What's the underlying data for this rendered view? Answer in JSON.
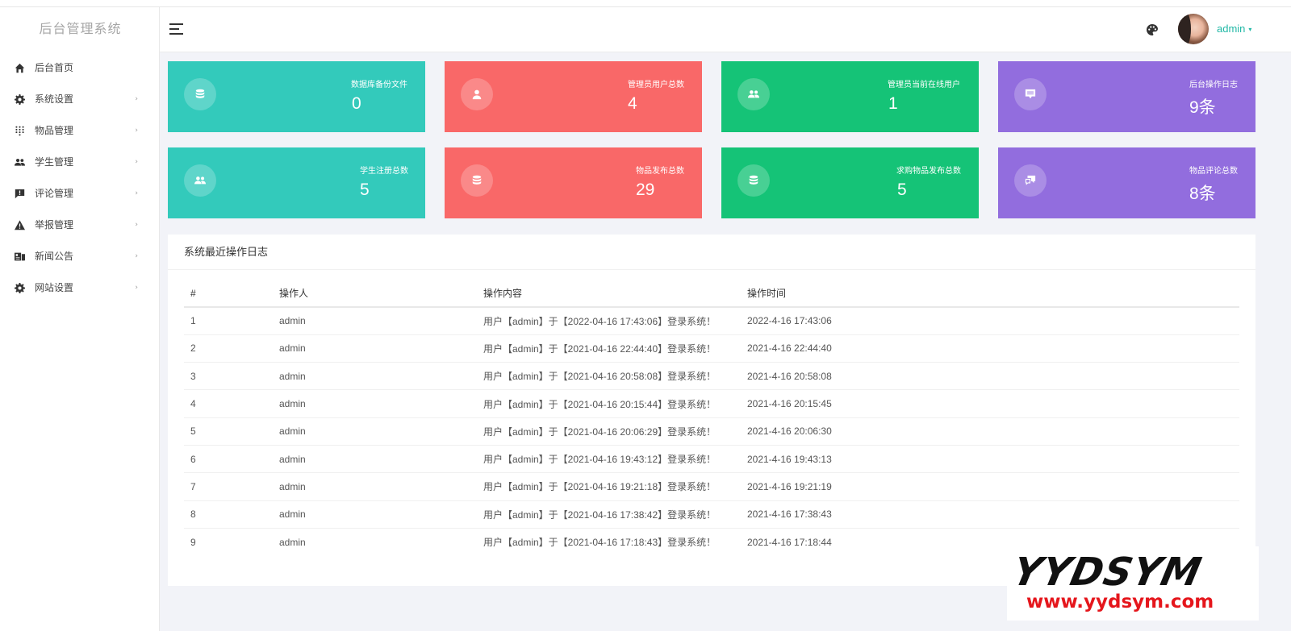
{
  "brand": "后台管理系统",
  "sidebar": {
    "items": [
      {
        "label": "后台首页",
        "icon": "home-icon",
        "has_children": false
      },
      {
        "label": "系统设置",
        "icon": "gear-icon",
        "has_children": true
      },
      {
        "label": "物品管理",
        "icon": "grid-dots-icon",
        "has_children": true
      },
      {
        "label": "学生管理",
        "icon": "users-icon",
        "has_children": true
      },
      {
        "label": "评论管理",
        "icon": "comment-alert-icon",
        "has_children": true
      },
      {
        "label": "举报管理",
        "icon": "warning-icon",
        "has_children": true
      },
      {
        "label": "新闻公告",
        "icon": "news-icon",
        "has_children": true
      },
      {
        "label": "网站设置",
        "icon": "gear-icon",
        "has_children": true
      }
    ],
    "chevron": "›"
  },
  "header": {
    "username": "admin",
    "caret": "▾"
  },
  "stats": [
    {
      "label": "数据库备份文件",
      "value": "0",
      "color": "#33cabb",
      "icon": "database-icon"
    },
    {
      "label": "管理员用户总数",
      "value": "4",
      "color": "#f96868",
      "icon": "user-icon"
    },
    {
      "label": "管理员当前在线用户",
      "value": "1",
      "color": "#15c377",
      "icon": "users-icon"
    },
    {
      "label": "后台操作日志",
      "value": "9条",
      "color": "#926dde",
      "icon": "message-icon"
    },
    {
      "label": "学生注册总数",
      "value": "5",
      "color": "#33cabb",
      "icon": "users-icon"
    },
    {
      "label": "物品发布总数",
      "value": "29",
      "color": "#f96868",
      "icon": "database-icon"
    },
    {
      "label": "求购物品发布总数",
      "value": "5",
      "color": "#15c377",
      "icon": "database-icon"
    },
    {
      "label": "物品评论总数",
      "value": "8条",
      "color": "#926dde",
      "icon": "comments-icon"
    }
  ],
  "log": {
    "title": "系统最近操作日志",
    "columns": [
      "#",
      "操作人",
      "操作内容",
      "操作时间"
    ],
    "rows": [
      [
        "1",
        "admin",
        "用户【admin】于【2022-04-16 17:43:06】登录系统！",
        "2022-4-16 17:43:06"
      ],
      [
        "2",
        "admin",
        "用户【admin】于【2021-04-16 22:44:40】登录系统！",
        "2021-4-16 22:44:40"
      ],
      [
        "3",
        "admin",
        "用户【admin】于【2021-04-16 20:58:08】登录系统！",
        "2021-4-16 20:58:08"
      ],
      [
        "4",
        "admin",
        "用户【admin】于【2021-04-16 20:15:44】登录系统！",
        "2021-4-16 20:15:45"
      ],
      [
        "5",
        "admin",
        "用户【admin】于【2021-04-16 20:06:29】登录系统！",
        "2021-4-16 20:06:30"
      ],
      [
        "6",
        "admin",
        "用户【admin】于【2021-04-16 19:43:12】登录系统！",
        "2021-4-16 19:43:13"
      ],
      [
        "7",
        "admin",
        "用户【admin】于【2021-04-16 19:21:18】登录系统！",
        "2021-4-16 19:21:19"
      ],
      [
        "8",
        "admin",
        "用户【admin】于【2021-04-16 17:38:42】登录系统！",
        "2021-4-16 17:38:43"
      ],
      [
        "9",
        "admin",
        "用户【admin】于【2021-04-16 17:18:43】登录系统！",
        "2021-4-16 17:18:44"
      ]
    ]
  },
  "watermark": {
    "top": "YYDSYM",
    "bottom": "www.yydsym.com"
  }
}
